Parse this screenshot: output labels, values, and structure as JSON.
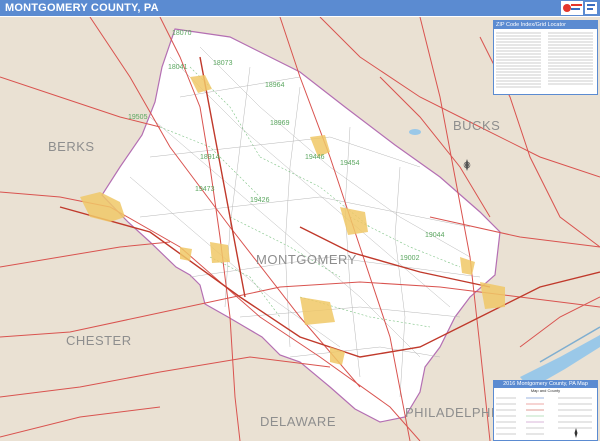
{
  "title": "MONTGOMERY COUNTY, PA",
  "regions": {
    "berks": "BERKS",
    "bucks": "BUCKS",
    "chester": "CHESTER",
    "montgomery": "MONTGOMERY",
    "delaware": "DELAWARE",
    "philadelphia": "PHILADELPHIA"
  },
  "zip_index": {
    "title": "ZIP Code Index/Grid Locator"
  },
  "legend": {
    "title": "2016 Montgomery County, PA Map",
    "subtitle": "Map and County"
  },
  "colors": {
    "title_bar": "#5b8bd1",
    "land": "#eae1d3",
    "county": "#ffffff",
    "road_red": "#d9534f",
    "urban": "#f0c867",
    "water": "#9ac8e8"
  }
}
